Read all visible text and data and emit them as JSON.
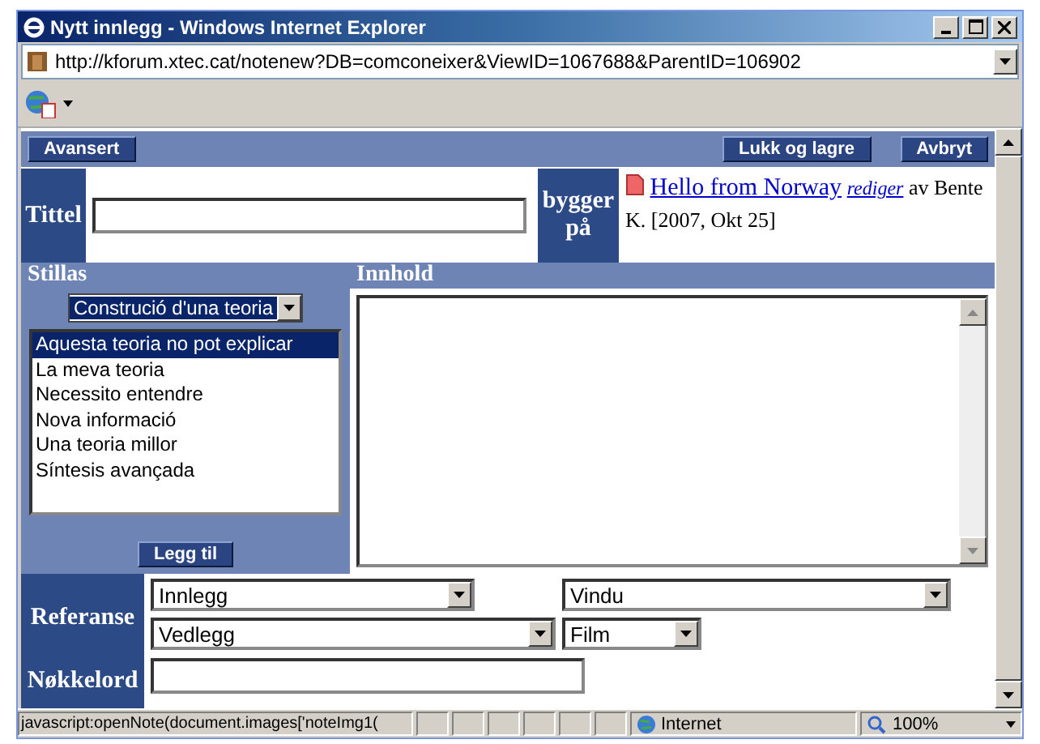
{
  "window": {
    "title": "Nytt innlegg - Windows Internet Explorer"
  },
  "address_bar": {
    "url": "http://kforum.xtec.cat/notenew?DB=comconeixer&ViewID=1067688&ParentID=106902"
  },
  "page": {
    "left_buttons": [
      "Avansert"
    ],
    "right_buttons": [
      "Lukk og lagre",
      "Avbryt"
    ],
    "title_field": {
      "label": "Tittel"
    },
    "builds_on": {
      "label": "bygger på",
      "link": "Hello from Norway",
      "edit_link": "rediger",
      "author": "av Bente K. [2007, Okt 25]"
    },
    "scaffold": {
      "label": "Stillas",
      "select": "Construció d'una teoria",
      "items": [
        {
          "label": "Aquesta teoria no pot explicar",
          "selected": true
        },
        {
          "label": "La meva teoria",
          "selected": false
        },
        {
          "label": "Necessito entendre",
          "selected": false
        },
        {
          "label": "Nova informació",
          "selected": false
        },
        {
          "label": "Una teoria millor",
          "selected": false
        },
        {
          "label": "Síntesis avançada",
          "selected": false
        }
      ],
      "add_button": "Legg til"
    },
    "content": {
      "label": "Innhold"
    },
    "reference": {
      "label": "Referanse",
      "selects": [
        "Innlegg",
        "Vindu",
        "Vedlegg",
        "Film"
      ]
    },
    "keywords": {
      "label": "Nøkkelord"
    }
  },
  "status_bar": {
    "text": "javascript:openNote(document.images['noteImg1(",
    "zone": "Internet",
    "zoom": "100%"
  }
}
